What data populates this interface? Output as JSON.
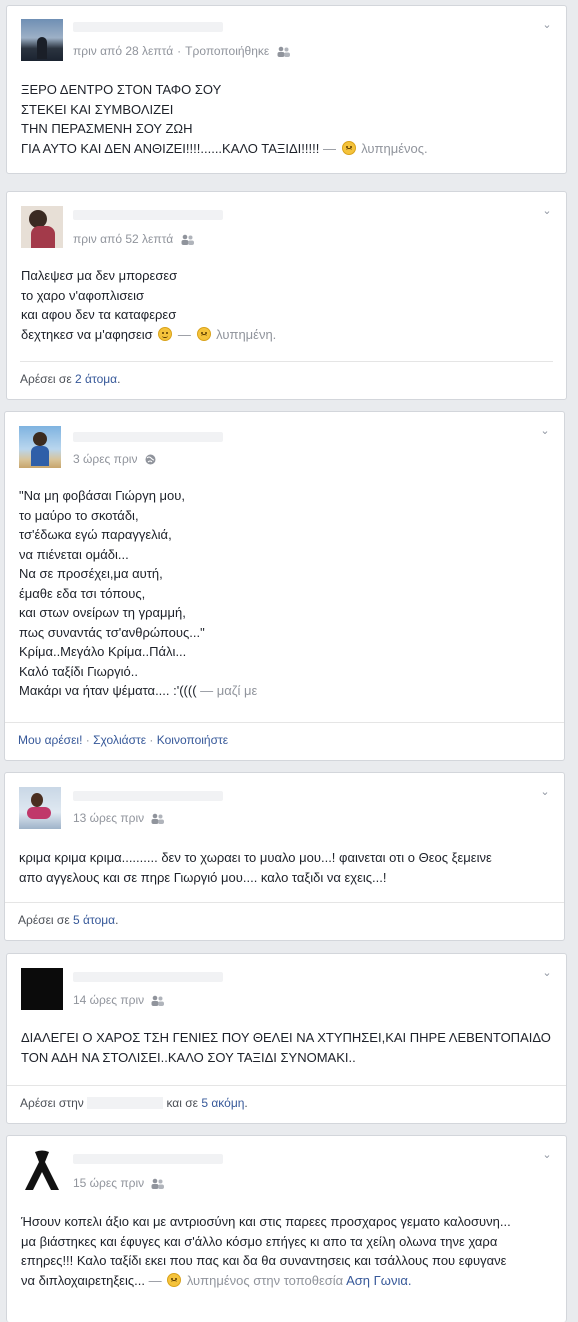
{
  "posts": [
    {
      "time": "πριν από 28 λεπτά",
      "edited": "Τροποποιήθηκε",
      "lines": [
        "ΞΕΡΟ ΔΕΝΤΡΟ ΣΤΟΝ ΤΑΦΟ ΣΟΥ",
        "ΣΤΕΚΕΙ ΚΑΙ ΣΥΜΒΟΛΙΖΕΙ",
        "ΤΗΝ ΠΕΡΑΣΜΕΝΗ ΣΟΥ ΖΩΗ",
        "ΓΙΑ ΑΥΤΟ ΚΑΙ ΔΕΝ ΑΝΘΙΖΕΙ!!!!......ΚΑΛΟ ΤΑΞΙΔΙ!!!!!"
      ],
      "feeling": "λυπημένος."
    },
    {
      "time": "πριν από 52 λεπτά",
      "lines": [
        "Παλεψεσ μα δεν μπορεσεσ",
        "το χαρο ν'αφοπλισεισ",
        "και αφου δεν τα καταφερεσ",
        "δεχτηκεσ να μ'αφησεισ"
      ],
      "feeling": "λυπημένη.",
      "likes_prefix": "Αρέσει σε",
      "likes_link": "2 άτομα",
      "likes_suffix": "."
    },
    {
      "time": "3 ώρες πριν",
      "lines": [
        "\"Να μη φοβάσαι Γιώργη μου,",
        "το μαύρο το σκοτάδι,",
        "τσ'έδωκα εγώ παραγγελιά,",
        "να πιένεται ομάδι...",
        "Να σε προσέχει,μα αυτή,",
        "έμαθε εδα τσι τόπους,",
        "και στων ονείρων τη γραμμή,",
        "πως συναντάς τσ'ανθρώπους...\"",
        "Κρίμα..Μεγάλο Κρίμα..Πάλι...",
        "Καλό ταξίδι Γιωργιό..",
        "Μακάρι να ήταν ψέματα.... :'(((("
      ],
      "with": "— μαζί με",
      "actions": [
        "Μου αρέσει!",
        "Σχολιάστε",
        "Κοινοποιήστε"
      ]
    },
    {
      "time": "13 ώρες πριν",
      "lines": [
        "κριμα κριμα κριμα.......... δεν το χωραει το μυαλο μου...! φαινεται οτι ο Θεος ξεμεινε",
        "απο αγγελους και σε πηρε Γιωργιό μου.... καλο ταξιδι να εχεις...!"
      ],
      "likes_prefix": "Αρέσει σε",
      "likes_link": "5 άτομα",
      "likes_suffix": "."
    },
    {
      "time": "14 ώρες πριν",
      "lines": [
        "ΔΙΑΛΕΓΕΙ Ο ΧΑΡΟΣ ΤΣΗ ΓΕΝΙΕΣ ΠΟΥ ΘΕΛΕΙ ΝΑ ΧΤΥΠΗΣΕΙ,ΚΑΙ ΠΗΡΕ ΛΕΒΕΝΤΟΠΑΙΔΟ",
        "ΤΟΝ ΑΔΗ ΝΑ ΣΤΟΛΙΣΕΙ..ΚΑΛΟ ΣΟΥ ΤΑΞΙΔΙ ΣΥΝΟΜΑΚΙ.."
      ],
      "likes_prefix": "Αρέσει στην",
      "likes_mid": "και σε",
      "likes_link": "5 ακόμη",
      "likes_suffix": "."
    },
    {
      "time": "15 ώρες πριν",
      "lines": [
        "Ήσουν κοπελι άξιο και με αντριοσύνη και στις παρεες προσχαρος γεματο καλοσυνη...",
        "μα βιάστηκες και έφυγες και σ'άλλο κόσμο επήγες κι απο τα χείλη ολωνα τηνε χαρα",
        "επηρες!!! Καλο ταξίδι εκει που πας και δα θα συναντησεις και τσάλλους που εφυγανε",
        "να διπλοχαιρετηξεις..."
      ],
      "feeling": "λυπημένος στην τοποθεσία",
      "place": "Αση Γωνια."
    }
  ]
}
